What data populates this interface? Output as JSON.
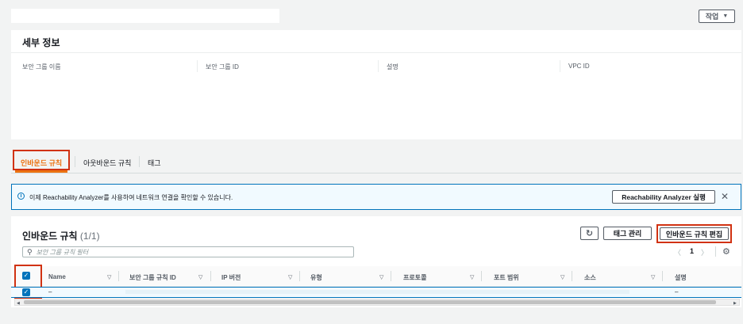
{
  "header": {
    "actions_label": "작업",
    "actions_caret": "▼"
  },
  "details": {
    "title": "세부 정보",
    "fields": [
      {
        "label": "보안 그룹 이름"
      },
      {
        "label": "보안 그룹 ID"
      },
      {
        "label": "설명"
      },
      {
        "label": "VPC ID"
      }
    ]
  },
  "tabs": [
    {
      "label": "인바운드 규칙",
      "active": true
    },
    {
      "label": "아웃바운드 규칙",
      "active": false
    },
    {
      "label": "태그",
      "active": false
    }
  ],
  "banner": {
    "info_icon": "i",
    "text": "이제 Reachability Analyzer를 사용하여 네트워크 연결을 확인할 수 있습니다.",
    "button_label": "Reachability Analyzer 실행",
    "close": "✕"
  },
  "rules": {
    "title": "인바운드 규칙",
    "count": "(1/1)",
    "refresh_icon": "↻",
    "manage_tags_label": "태그 관리",
    "edit_label": "인바운드 규칙 편집",
    "search_placeholder": "보안 그룹 규칙 필터",
    "pagination": {
      "prev": "〈",
      "page": "1",
      "next": "〉"
    },
    "settings_icon": "⚙",
    "columns": [
      "Name",
      "보안 그룹 규칙 ID",
      "IP 버전",
      "유형",
      "프로토콜",
      "포트 범위",
      "소스",
      "설명"
    ],
    "rows": [
      {
        "name": "–",
        "description": "–"
      }
    ],
    "check": "✓"
  },
  "colors": {
    "accent": "#0073bb",
    "active_tab": "#ec7211",
    "highlight": "#d13212"
  }
}
